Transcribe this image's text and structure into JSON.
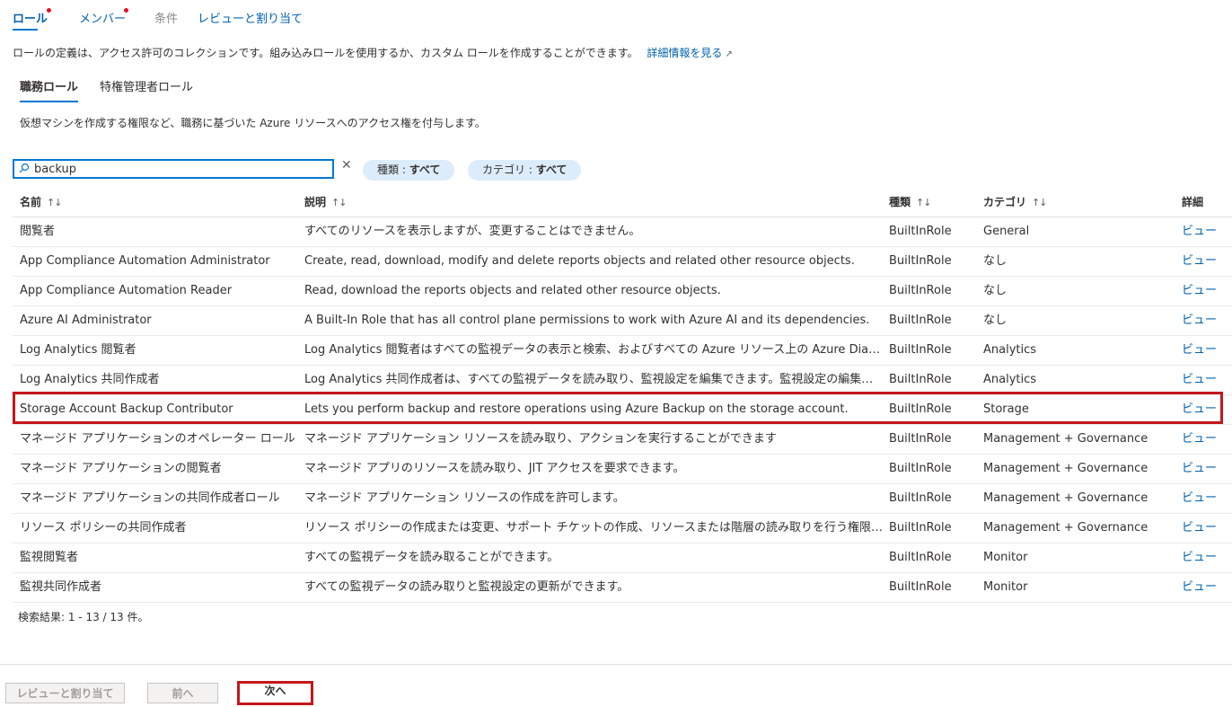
{
  "tabs": [
    {
      "label": "ロール",
      "active": true,
      "required": true
    },
    {
      "label": "メンバー",
      "active": false,
      "required": true
    },
    {
      "label": "条件",
      "active": false,
      "disabled": true
    },
    {
      "label": "レビューと割り当て",
      "active": false
    }
  ],
  "description": {
    "text": "ロールの定義は、アクセス許可のコレクションです。組み込みロールを使用するか、カスタム ロールを作成することができます。",
    "link": "詳細情報を見る",
    "link_icon": "external-link-icon"
  },
  "sub_tabs": [
    {
      "label": "職務ロール",
      "active": true
    },
    {
      "label": "特権管理者ロール",
      "active": false
    }
  ],
  "sub_description": "仮想マシンを作成する権限など、職務に基づいた Azure リソースへのアクセス権を付与します。",
  "search": {
    "value": "backup",
    "icon": "search-icon",
    "clear_icon": "close-icon"
  },
  "filters": {
    "type": {
      "label": "種類 : ",
      "value": "すべて"
    },
    "category": {
      "label": "カテゴリ : ",
      "value": "すべて"
    }
  },
  "table": {
    "headers": {
      "name": "名前",
      "description": "説明",
      "type": "種類",
      "category": "カテゴリ",
      "details": "詳細"
    },
    "sort_icon": "↑↓",
    "rows": [
      {
        "name": "閲覧者",
        "description": "すべてのリソースを表示しますが、変更することはできません。",
        "type": "BuiltInRole",
        "category": "General",
        "details": "ビュー"
      },
      {
        "name": "App Compliance Automation Administrator",
        "description": "Create, read, download, modify and delete reports objects and related other resource objects.",
        "type": "BuiltInRole",
        "category": "なし",
        "details": "ビュー"
      },
      {
        "name": "App Compliance Automation Reader",
        "description": "Read, download the reports objects and related other resource objects.",
        "type": "BuiltInRole",
        "category": "なし",
        "details": "ビュー"
      },
      {
        "name": "Azure AI Administrator",
        "description": "A Built-In Role that has all control plane permissions to work with Azure AI and its dependencies.",
        "type": "BuiltInRole",
        "category": "なし",
        "details": "ビュー"
      },
      {
        "name": "Log Analytics 閲覧者",
        "description": "Log Analytics 閲覧者はすべての監視データの表示と検索、およびすべての Azure リソース上の Azure Diagnostics の構成の表示などを行うことができます。",
        "type": "BuiltInRole",
        "category": "Analytics",
        "details": "ビュー"
      },
      {
        "name": "Log Analytics 共同作成者",
        "description": "Log Analytics 共同作成者は、すべての監視データを読み取り、監視設定を編集できます。監視設定の編集には、VM への拡張機能の追加が含まれます。",
        "type": "BuiltInRole",
        "category": "Analytics",
        "details": "ビュー"
      },
      {
        "name": "Storage Account Backup Contributor",
        "description": "Lets you perform backup and restore operations using Azure Backup on the storage account.",
        "type": "BuiltInRole",
        "category": "Storage",
        "details": "ビュー"
      },
      {
        "name": "マネージド アプリケーションのオペレーター ロール",
        "description": "マネージド アプリケーション リソースを読み取り、アクションを実行することができます",
        "type": "BuiltInRole",
        "category": "Management + Governance",
        "details": "ビュー"
      },
      {
        "name": "マネージド アプリケーションの閲覧者",
        "description": "マネージド アプリのリソースを読み取り、JIT アクセスを要求できます。",
        "type": "BuiltInRole",
        "category": "Management + Governance",
        "details": "ビュー"
      },
      {
        "name": "マネージド アプリケーションの共同作成者ロール",
        "description": "マネージド アプリケーション リソースの作成を許可します。",
        "type": "BuiltInRole",
        "category": "Management + Governance",
        "details": "ビュー"
      },
      {
        "name": "リソース ポリシーの共同作成者",
        "description": "リソース ポリシーの作成または変更、サポート チケットの作成、リソースまたは階層の読み取りを行う権限を持つユーザー。",
        "type": "BuiltInRole",
        "category": "Management + Governance",
        "details": "ビュー"
      },
      {
        "name": "監視閲覧者",
        "description": "すべての監視データを読み取ることができます。",
        "type": "BuiltInRole",
        "category": "Monitor",
        "details": "ビュー"
      },
      {
        "name": "監視共同作成者",
        "description": "すべての監視データの読み取りと監視設定の更新ができます。",
        "type": "BuiltInRole",
        "category": "Monitor",
        "details": "ビュー"
      }
    ]
  },
  "results_text": "検索結果: 1 - 13 / 13 件。",
  "footer": {
    "review_assign": "レビューと割り当て",
    "previous": "前へ",
    "next": "次へ"
  },
  "colors": {
    "accent": "#0078d4",
    "link": "#0062ad",
    "highlight": "#c4161c",
    "required_dot": "#e81123",
    "pill": "#dcecfa"
  }
}
